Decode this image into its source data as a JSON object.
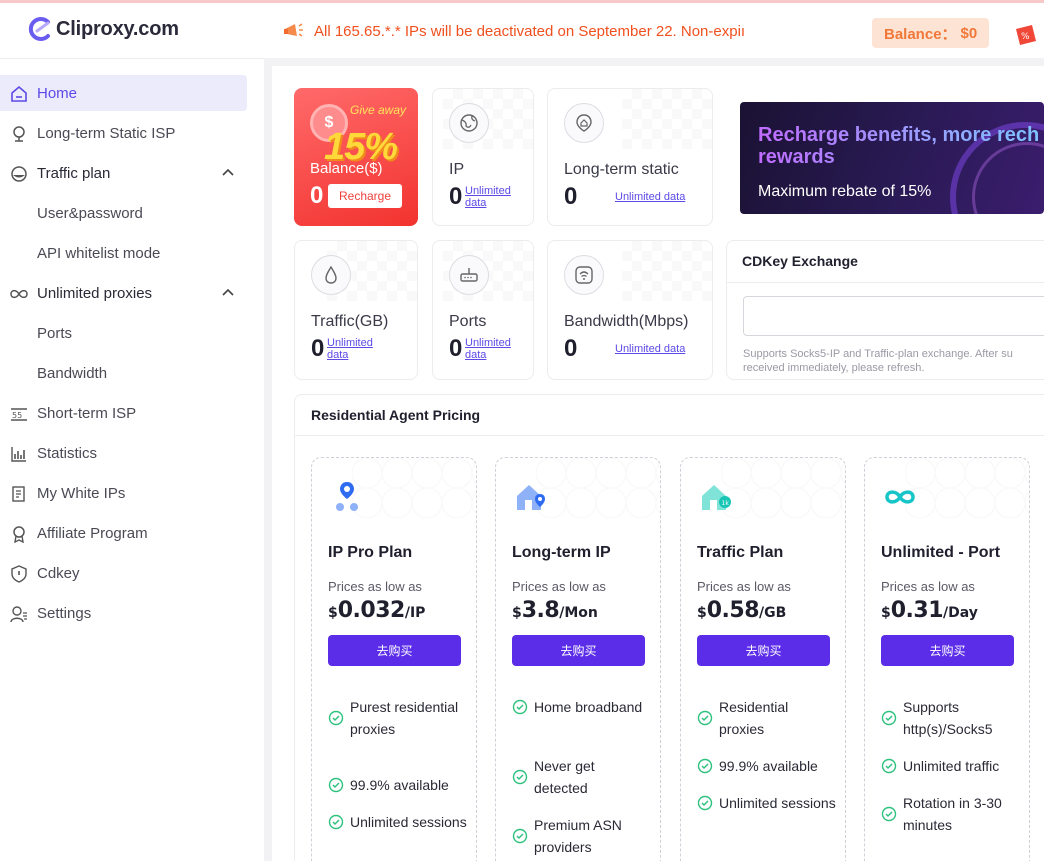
{
  "topbar": {
    "logo_text": "Cliproxy.com",
    "notice": "All 165.65.*.* IPs will be deactivated on September 22. Non-expiı",
    "balance_label": "Balance：",
    "balance_value": "$0"
  },
  "sidebar": {
    "items": [
      {
        "label": "Home",
        "icon": "home-icon",
        "active": true
      },
      {
        "label": "Long-term Static ISP",
        "icon": "location-pin-icon"
      },
      {
        "label": "Traffic plan",
        "icon": "drop-icon",
        "expanded": true
      },
      {
        "label": "User&password",
        "sub": true
      },
      {
        "label": "API whitelist mode",
        "sub": true
      },
      {
        "label": "Unlimited proxies",
        "icon": "infinity-icon",
        "expanded": true
      },
      {
        "label": "Ports",
        "sub": true
      },
      {
        "label": "Bandwidth",
        "sub": true
      },
      {
        "label": "Short-term ISP",
        "icon": "short-term-icon"
      },
      {
        "label": "Statistics",
        "icon": "bar-chart-icon"
      },
      {
        "label": "My White IPs",
        "icon": "document-icon"
      },
      {
        "label": "Affiliate Program",
        "icon": "badge-icon"
      },
      {
        "label": "Cdkey",
        "icon": "shield-icon"
      },
      {
        "label": "Settings",
        "icon": "user-settings-icon"
      }
    ]
  },
  "balance_card": {
    "give_away": "Give away",
    "percent": "15%",
    "label": "Balance($)",
    "value": "0",
    "recharge": "Recharge",
    "coin": "$"
  },
  "stats": {
    "ip": {
      "label": "IP",
      "value": "0",
      "link_line1": "Unlimited",
      "link_line2": "data"
    },
    "long_term": {
      "label": "Long-term static",
      "value": "0",
      "link": "Unlimited data"
    },
    "traffic": {
      "label": "Traffic(GB)",
      "value": "0",
      "link_line1": "Unlimited",
      "link_line2": "data"
    },
    "ports": {
      "label": "Ports",
      "value": "0",
      "link_line1": "Unlimited",
      "link_line2": "data"
    },
    "bandwidth": {
      "label": "Bandwidth(Mbps)",
      "value": "0",
      "link": "Unlimited data"
    }
  },
  "banner": {
    "title_line1": "Recharge benefits, more rech",
    "title_line2": "rewards",
    "subtitle": "Maximum rebate of 15%"
  },
  "cdkey": {
    "title": "CDKey Exchange",
    "hint_line1": "Supports Socks5-IP and Traffic-plan exchange. After su",
    "hint_line2": "received immediately, please refresh."
  },
  "pricing": {
    "title": "Residential Agent Pricing",
    "plans": [
      {
        "name": "IP Pro Plan",
        "low": "Prices as low as",
        "currency": "$",
        "price": "0.032",
        "unit": "/IP",
        "button": "去购买",
        "features": [
          "Purest residential proxies",
          "99.9% available",
          "Unlimited sessions"
        ]
      },
      {
        "name": "Long-term IP",
        "low": "Prices as low as",
        "currency": "$",
        "price": "3.8",
        "unit": "/Mon",
        "button": "去购买",
        "features": [
          "Home broadband",
          "Never get detected",
          "Premium ASN providers"
        ]
      },
      {
        "name": "Traffic Plan",
        "low": "Prices as low as",
        "currency": "$",
        "price": "0.58",
        "unit": "/GB",
        "button": "去购买",
        "features": [
          "Residential proxies",
          "99.9% available",
          "Unlimited sessions"
        ]
      },
      {
        "name": "Unlimited - Port",
        "low": "Prices as low as",
        "currency": "$",
        "price": "0.31",
        "unit": "/Day",
        "button": "去购买",
        "features": [
          "Supports http(s)/Socks5",
          "Unlimited traffic",
          "Rotation in 3-30 minutes"
        ]
      }
    ]
  },
  "colors": {
    "accent": "#5b2de8",
    "nav_active": "#5b4ae6",
    "notice": "#f0501e",
    "balance_pill": "#f07838"
  }
}
